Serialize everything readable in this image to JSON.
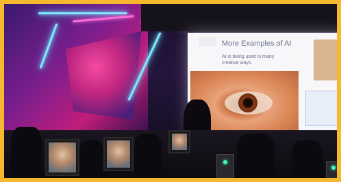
{
  "scene": {
    "border_color": "#f5b82e",
    "neon_colors": [
      "#7fe8ff",
      "#ff6bd8"
    ],
    "description_items": [
      "neon-wall",
      "presentation-screen",
      "presenter",
      "monitors",
      "chairs"
    ]
  },
  "slide": {
    "title": "More Examples of AI",
    "body": "AI is being used in many creative ways."
  }
}
